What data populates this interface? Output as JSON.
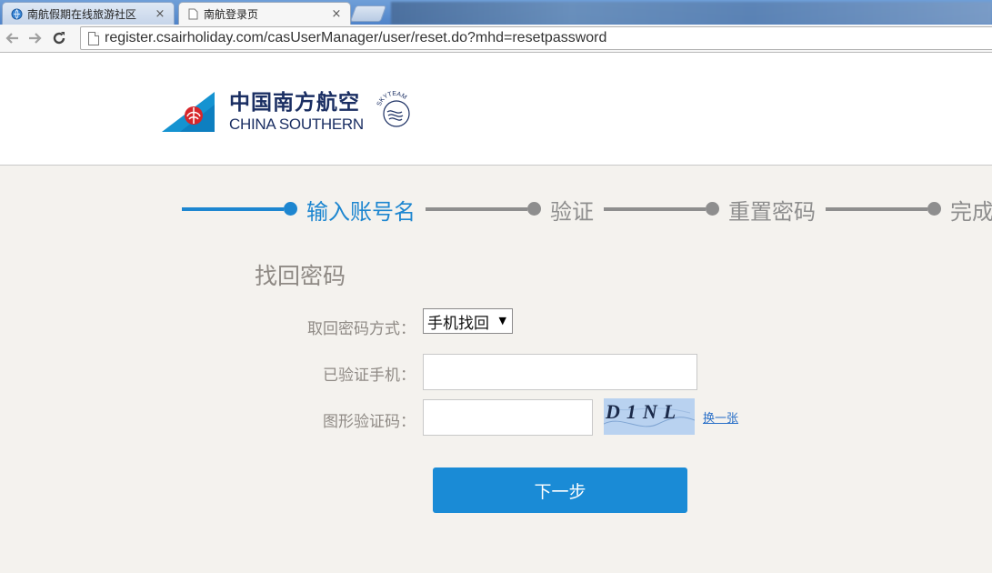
{
  "browser": {
    "tabs": [
      {
        "title": "南航假期在线旅游社区",
        "close": "×",
        "icon": "globe-icon"
      },
      {
        "title": "南航登录页",
        "close": "×",
        "icon": "page-icon"
      }
    ],
    "url": "register.csairholiday.com/casUserManager/user/reset.do?mhd=resetpassword"
  },
  "header": {
    "logo_cn": "中国南方航空",
    "logo_en": "CHINA SOUTHERN",
    "skyteam": "SKYTEAM"
  },
  "steps": [
    {
      "label": "输入账号名",
      "state": "active"
    },
    {
      "label": "验证",
      "state": "pending"
    },
    {
      "label": "重置密码",
      "state": "pending"
    },
    {
      "label": "完成",
      "state": "pending"
    }
  ],
  "form": {
    "title": "找回密码",
    "method_label": "取回密码方式：",
    "method_selected": "手机找回",
    "phone_label": "已验证手机：",
    "phone_value": "",
    "captcha_label": "图形验证码：",
    "captcha_value": "",
    "captcha_text": "D1NL",
    "change_link": "换一张",
    "next_button": "下一步"
  },
  "colors": {
    "accent": "#1d86d0",
    "button": "#1a8bd6",
    "idle_step": "#8e8e8e",
    "page_background": "#f4f2ee",
    "brand_navy": "#1b2f63"
  }
}
